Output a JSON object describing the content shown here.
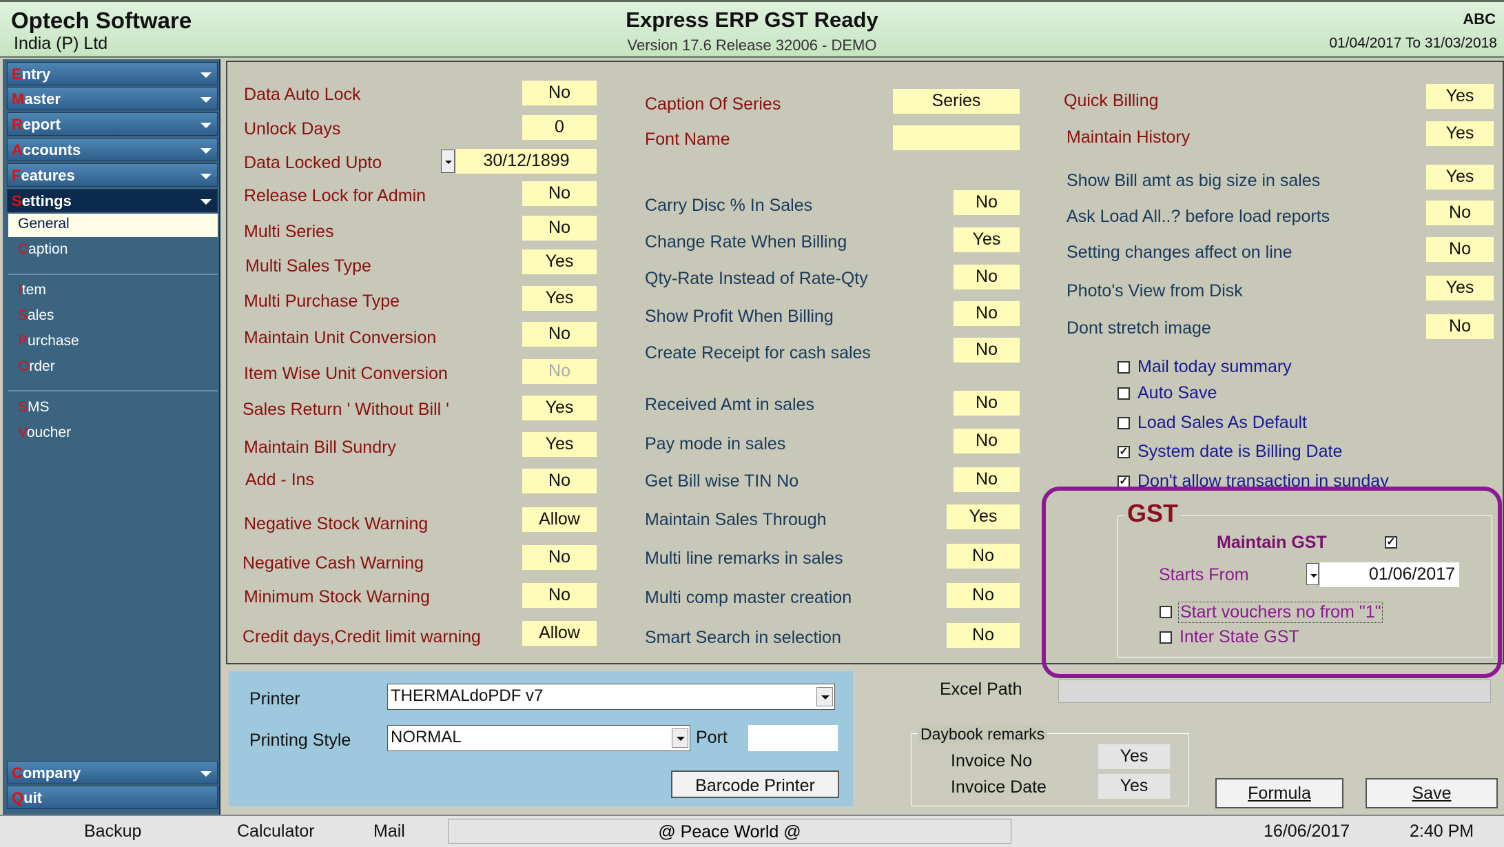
{
  "header": {
    "company_name": "Optech Software",
    "company_sub": "India (P) Ltd",
    "app_title": "Express ERP GST Ready",
    "app_version": "Version 17.6 Release 32006 - DEMO",
    "user": "ABC",
    "fin_year": "01/04/2017 To 31/03/2018"
  },
  "sidebar": {
    "entry": {
      "first": "E",
      "rest": "ntry"
    },
    "master": {
      "first": "M",
      "rest": "aster"
    },
    "report": {
      "first": "R",
      "rest": "eport"
    },
    "accounts": {
      "first": "A",
      "rest": "ccounts"
    },
    "features": {
      "first": "F",
      "rest": "eatures"
    },
    "settings": {
      "first": "S",
      "rest": "ettings"
    },
    "general": "General",
    "caption": {
      "first": "C",
      "rest": "aption"
    },
    "item": {
      "first": "I",
      "rest": "tem"
    },
    "sales": {
      "first": "S",
      "rest": "ales"
    },
    "purchase": {
      "first": "P",
      "rest": "urchase"
    },
    "order": {
      "first": "O",
      "rest": "rder"
    },
    "sms": {
      "first": "S",
      "rest": "MS"
    },
    "voucher": {
      "first": "V",
      "rest": "oucher"
    },
    "company": {
      "first": "C",
      "rest": "ompany"
    },
    "quit": {
      "first": "Q",
      "rest": "uit"
    }
  },
  "col1": [
    {
      "label": "Data Auto Lock",
      "value": "No"
    },
    {
      "label": "Unlock Days",
      "value": "0"
    },
    {
      "label": "Data Locked Upto",
      "value": "30/12/1899"
    },
    {
      "label": "Release Lock for Admin",
      "value": "No"
    },
    {
      "label": "Multi Series",
      "value": "No"
    },
    {
      "label": "Multi Sales Type",
      "value": "Yes"
    },
    {
      "label": "Multi Purchase Type",
      "value": "Yes"
    },
    {
      "label": "Maintain Unit Conversion",
      "value": "No"
    },
    {
      "label": "Item Wise Unit Conversion",
      "value": "No"
    },
    {
      "label": "Sales Return ' Without Bill '",
      "value": "Yes"
    },
    {
      "label": "Maintain Bill Sundry",
      "value": "Yes"
    },
    {
      "label": "Add - Ins",
      "value": "No"
    },
    {
      "label": "Negative Stock Warning",
      "value": "Allow"
    },
    {
      "label": "Negative Cash Warning",
      "value": "No"
    },
    {
      "label": "Minimum Stock Warning",
      "value": "No"
    },
    {
      "label": "Credit days,Credit limit warning",
      "value": "Allow"
    }
  ],
  "col2": [
    {
      "label": "Caption Of Series",
      "value": "Series"
    },
    {
      "label": "Font Name",
      "value": ""
    },
    {
      "label": "Carry Disc % In Sales",
      "value": "No"
    },
    {
      "label": "Change Rate When Billing",
      "value": "Yes"
    },
    {
      "label": "Qty-Rate Instead of Rate-Qty",
      "value": "No"
    },
    {
      "label": "Show Profit When Billing",
      "value": "No"
    },
    {
      "label": "Create Receipt for cash sales",
      "value": "No"
    },
    {
      "label": "Received Amt in sales",
      "value": "No"
    },
    {
      "label": "Pay mode in sales",
      "value": "No"
    },
    {
      "label": "Get Bill wise TIN No",
      "value": "No"
    },
    {
      "label": "Maintain Sales Through",
      "value": "Yes"
    },
    {
      "label": "Multi line remarks in sales",
      "value": "No"
    },
    {
      "label": "Multi comp master creation",
      "value": "No"
    },
    {
      "label": "Smart Search in selection",
      "value": "No"
    }
  ],
  "col3": [
    {
      "label": "Quick  Billing",
      "value": "Yes"
    },
    {
      "label": "Maintain History",
      "value": "Yes"
    },
    {
      "label": "Show Bill amt as big size in sales",
      "value": "Yes"
    },
    {
      "label": "Ask Load All..? before load reports",
      "value": "No"
    },
    {
      "label": "Setting changes affect on line",
      "value": "No"
    },
    {
      "label": "Photo's View from Disk",
      "value": "Yes"
    },
    {
      "label": "Dont stretch image",
      "value": "No"
    }
  ],
  "checks": [
    {
      "label": "Mail today summary",
      "checked": ""
    },
    {
      "label": "Auto Save",
      "checked": ""
    },
    {
      "label": "Load Sales As Default",
      "checked": ""
    },
    {
      "label": "System date is Billing Date",
      "checked": "✓"
    },
    {
      "label": "Don't allow transaction in sunday",
      "checked": "✓"
    }
  ],
  "gst": {
    "title": "GST",
    "maintain_label": "Maintain GST",
    "maintain_checked": "✓",
    "starts_label": "Starts From",
    "starts_value": "01/06/2017",
    "vouchers_label": "Start vouchers no from \"1\"",
    "interstate_label": "Inter State GST"
  },
  "printer": {
    "printer_label": "Printer",
    "printer_value": "THERMALdoPDF v7",
    "style_label": "Printing Style",
    "style_value": "NORMAL",
    "port_label": "Port",
    "port_value": "",
    "barcode_button": "Barcode Printer"
  },
  "excel": {
    "label": "Excel Path",
    "value": ""
  },
  "daybook": {
    "title": "Daybook remarks",
    "invoice_no_label": "Invoice No",
    "invoice_no_value": "Yes",
    "invoice_date_label": "Invoice Date",
    "invoice_date_value": "Yes"
  },
  "buttons": {
    "formula": "Formula",
    "save": "Save"
  },
  "statusbar": {
    "backup": "Backup",
    "calculator": "Calculator",
    "mail": "Mail",
    "message": "@ Peace World @",
    "date": "16/06/2017",
    "time": "2:40 PM"
  }
}
